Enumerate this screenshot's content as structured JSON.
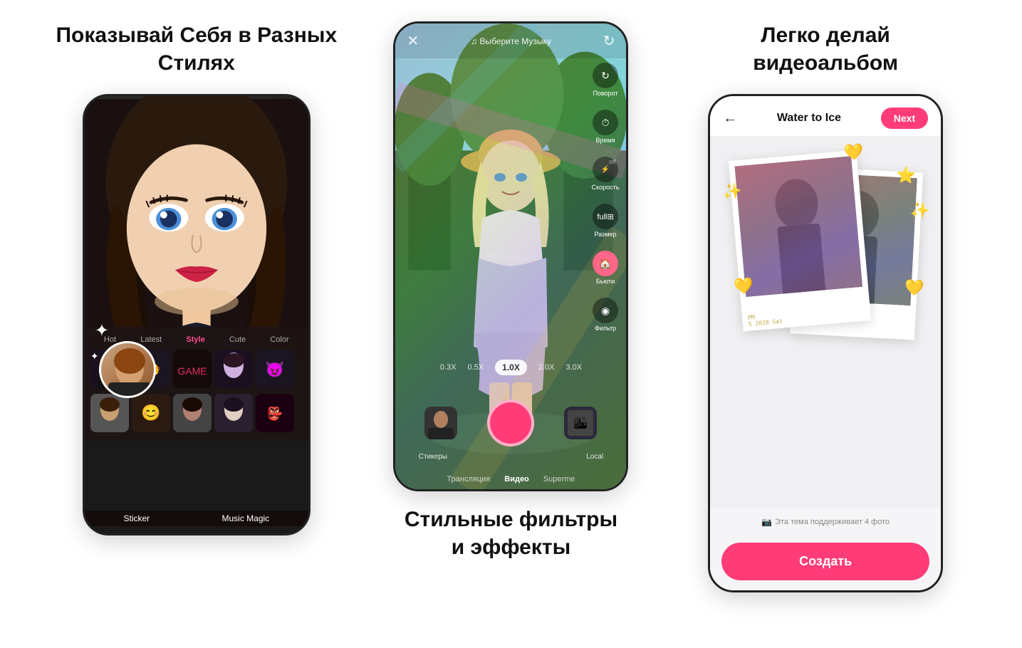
{
  "left_panel": {
    "title": "Показывай Себя\nв Разных Стилях",
    "tabs": [
      "Hot",
      "Latest",
      "Style",
      "Cute",
      "Color"
    ],
    "active_tab": "Style",
    "bottom_labels": [
      "Sticker",
      "Music Magic"
    ]
  },
  "middle_panel": {
    "music_label": "♫ Выберите Музыку",
    "controls": [
      {
        "icon": "↻",
        "label": "Поворот"
      },
      {
        "icon": "⏱",
        "label": "Время"
      },
      {
        "icon": "⚡",
        "label": "Скорость"
      },
      {
        "icon": "⊞",
        "label": "Размер"
      },
      {
        "icon": "🏠",
        "label": "Бьюти"
      },
      {
        "icon": "◉",
        "label": "Фильтр"
      }
    ],
    "zoom_levels": [
      "0.3X",
      "0.5X",
      "1.0X",
      "2.0X",
      "3.0X"
    ],
    "active_zoom": "1.0X",
    "sticker_label": "Стикеры",
    "local_label": "Local",
    "modes": [
      "Трансляция",
      "Видео",
      "Superme"
    ],
    "active_mode": "Видео",
    "subtitle": "Стильные фильтры\nи эффекты",
    "watermark": "TheProgs.ru"
  },
  "right_panel": {
    "title": "Легко делай\nвидеоальбом",
    "header": {
      "back_icon": "←",
      "title": "Water to Ice",
      "next_btn": "Next"
    },
    "support_text": "Эта тема поддерживает 4 фото",
    "create_btn": "Создать",
    "polaroid_date": "PM\nS 2020 Sat"
  }
}
